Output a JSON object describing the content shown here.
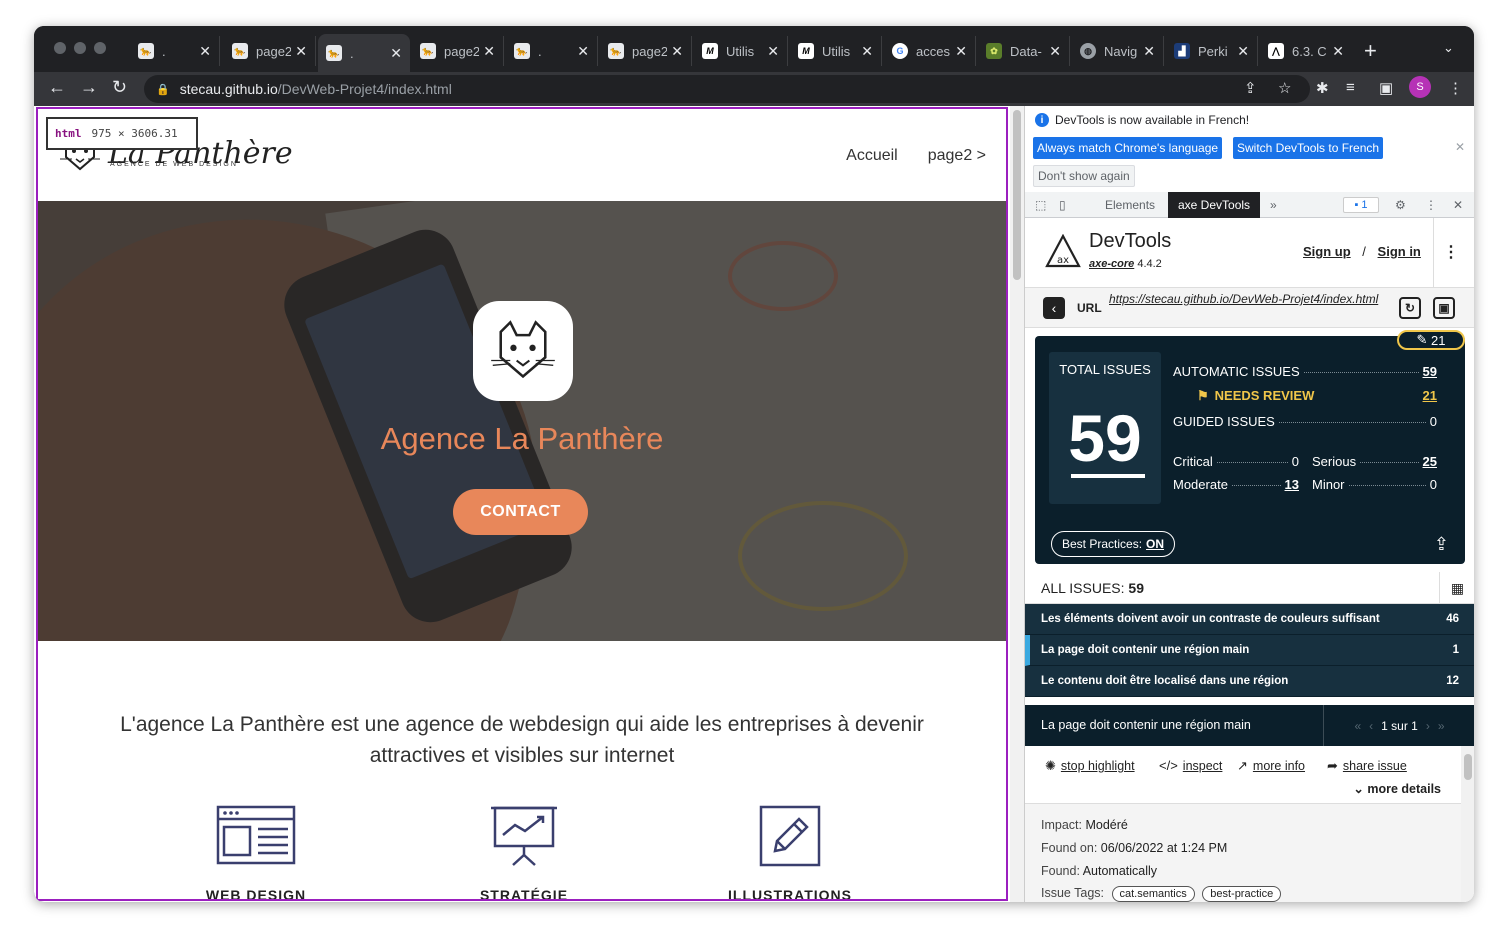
{
  "browser": {
    "tabs": [
      {
        "title": ".",
        "favicon": "panther-icon"
      },
      {
        "title": "page2",
        "favicon": "panther-icon"
      },
      {
        "title": ".",
        "favicon": "panther-icon"
      },
      {
        "title": "page2",
        "favicon": "panther-icon"
      },
      {
        "title": ".",
        "favicon": "panther-icon"
      },
      {
        "title": "page2",
        "favicon": "panther-icon"
      },
      {
        "title": "Utilis",
        "favicon": "m-icon"
      },
      {
        "title": "Utilis",
        "favicon": "m-icon"
      },
      {
        "title": "acces",
        "favicon": "google-icon"
      },
      {
        "title": "Data-",
        "favicon": "data-icon"
      },
      {
        "title": "Navig",
        "favicon": "globe-icon"
      },
      {
        "title": "Perki",
        "favicon": "perki-icon"
      },
      {
        "title": "6.3. C",
        "favicon": "doc-icon"
      }
    ],
    "url_host": "stecau.github.io",
    "url_path": "/DevWeb-Projet4/index.html",
    "profile_initial": "S",
    "accent_color": "#b632b6"
  },
  "page": {
    "inspector_tag": "html",
    "inspector_size": "975 × 3606.31",
    "logo_text": "La Panthère",
    "logo_sub": "AGENCE DE WEB DESIGN",
    "nav": [
      "Accueil",
      "page2 >"
    ],
    "hero_title": "Agence La Panthère",
    "cta_label": "CONTACT",
    "tagline": "L'agence La Panthère est une agence de webdesign qui aide les entreprises à devenir attractives et visibles sur internet",
    "services": [
      "WEB DESIGN",
      "STRATÉGIE",
      "ILLUSTRATIONS"
    ],
    "accent_color": "#e8875a"
  },
  "devtools": {
    "notice": "DevTools is now available in French!",
    "btn_match": "Always match Chrome's language",
    "btn_switch": "Switch DevTools to French",
    "btn_dont_show": "Don't show again",
    "tabs": [
      "Elements",
      "axe DevTools",
      "»"
    ],
    "message_count": "1",
    "axe": {
      "title": "DevTools",
      "core_label": "axe-core",
      "core_version": "4.4.2",
      "sign_up": "Sign up",
      "sign_in": "Sign in",
      "url_label": "URL",
      "url_value": "https://stecau.github.io/DevWeb-Projet4/index.html",
      "review_count": "21",
      "total_label": "TOTAL ISSUES",
      "total": "59",
      "automatic_label": "AUTOMATIC ISSUES",
      "automatic": "59",
      "needs_review_label": "NEEDS REVIEW",
      "needs_review": "21",
      "guided_label": "GUIDED ISSUES",
      "guided": "0",
      "critical_label": "Critical",
      "critical": "0",
      "serious_label": "Serious",
      "serious": "25",
      "moderate_label": "Moderate",
      "moderate": "13",
      "minor_label": "Minor",
      "minor": "0",
      "best_practices_label": "Best Practices:",
      "best_practices_value": "ON",
      "all_issues_label": "ALL ISSUES:",
      "all_issues_count": "59",
      "issues": [
        {
          "title": "Les éléments doivent avoir un contraste de couleurs suffisant",
          "count": "46"
        },
        {
          "title": "La page doit contenir une région main",
          "count": "1"
        },
        {
          "title": "Le contenu doit être localisé dans une région",
          "count": "12"
        }
      ],
      "detail_title": "La page doit contenir une région main",
      "pager": "1 sur 1",
      "actions": [
        "stop highlight",
        "inspect",
        "more info",
        "share issue"
      ],
      "more_details": "more details",
      "impact_label": "Impact:",
      "impact": "Modéré",
      "found_on_label": "Found on:",
      "found_on": "06/06/2022 at 1:24 PM",
      "found_label": "Found:",
      "found": "Automatically",
      "tags_label": "Issue Tags:",
      "tags": [
        "cat.semantics",
        "best-practice"
      ],
      "summary_bg": "#0b1f2b",
      "review_color": "#f0c64a"
    }
  }
}
